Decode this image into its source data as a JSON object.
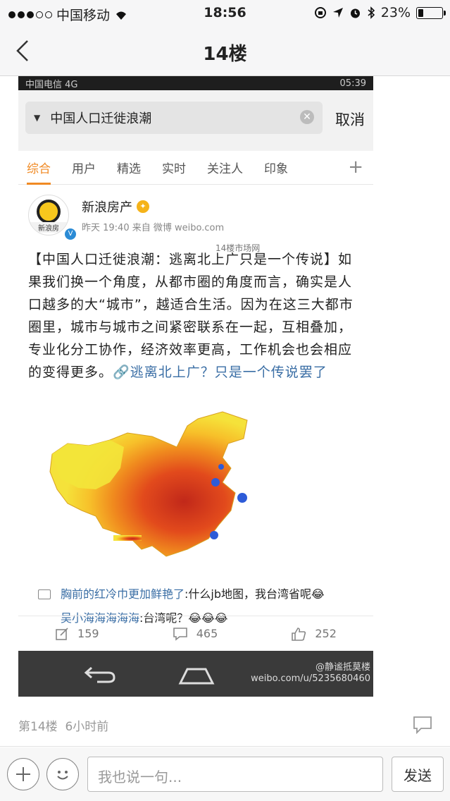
{
  "status_bar": {
    "carrier": "中国移动",
    "time": "18:56",
    "battery": "23%",
    "battery_level": 0.23
  },
  "nav": {
    "title": "14楼",
    "back_icon": "chevron-left-icon"
  },
  "embedded": {
    "status": {
      "left": "中国电信 4G",
      "right": "05:39"
    },
    "search": {
      "query": "中国人口迁徙浪潮",
      "cancel_label": "取消"
    },
    "tabs": [
      "综合",
      "用户",
      "精选",
      "实时",
      "关注人",
      "印象"
    ],
    "active_tab": "综合",
    "post": {
      "avatar_label": "新浪房",
      "author": "新浪房产",
      "time": "昨天 19:40  来自 微博 weibo.com",
      "body": "【中国人口迁徙浪潮：逃离北上广只是一个传说】如果我们换一个角度，从都市圈的角度而言，确实是人口越多的大“城市”，越适合生活。因为在这三大都市圈里，城市与城市之间紧密联系在一起，互相叠加，专业化分工协作，经济效率更高，工作机会也会相应的变得更多。",
      "link": "逃离北上广？只是一个传说罢了",
      "map_watermark": "14楼市场网"
    },
    "comments": [
      {
        "user": "胸前的红冷巾更加鲜艳了",
        "text": ":什么jb地图，我台湾省呢😂"
      },
      {
        "user": "吴小海海海海海",
        "text": ":台湾呢？😂😂😂"
      }
    ],
    "actions": {
      "repost": "159",
      "comment": "465",
      "like": "252"
    },
    "watermark": "@静谧抵莫楼 weibo.com/u/5235680460"
  },
  "floor": {
    "label": "第14楼",
    "time": "6小时前"
  },
  "reply_bar": {
    "placeholder": "我也说一句...",
    "send_label": "发送"
  }
}
